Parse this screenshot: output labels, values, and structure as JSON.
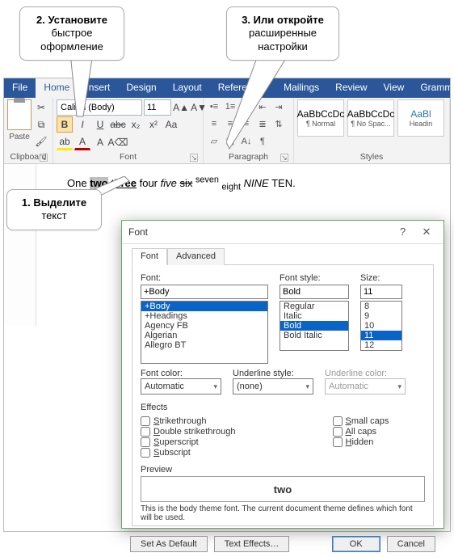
{
  "callouts": {
    "c1": {
      "bold": "1. Выделите",
      "rest": "текст"
    },
    "c2": {
      "bold": "2. Установите",
      "rest": "быстрое оформление"
    },
    "c3": {
      "bold": "3. Или откройте",
      "rest": "расширенные настройки"
    }
  },
  "ribbon": {
    "tabs": [
      "File",
      "Home",
      "Insert",
      "Design",
      "Layout",
      "References",
      "Mailings",
      "Review",
      "View",
      "Grammarly"
    ],
    "active_tab": "Home",
    "groups": {
      "clipboard": {
        "label": "Clipboard",
        "paste": "Paste"
      },
      "font": {
        "label": "Font",
        "name": "Calibri (Body)",
        "size": "11"
      },
      "paragraph": {
        "label": "Paragraph"
      },
      "styles": {
        "label": "Styles",
        "items": [
          {
            "sample": "AaBbCcDc",
            "name": "¶ Normal"
          },
          {
            "sample": "AaBbCcDc",
            "name": "¶ No Spac..."
          },
          {
            "sample": "AaBl",
            "name": "Headin"
          }
        ]
      }
    }
  },
  "document": {
    "tokens": [
      "One ",
      "two",
      " ",
      "three",
      " four ",
      "five",
      " ",
      "six",
      " ",
      "seven",
      " ",
      "eight",
      " ",
      "NINE",
      " TEN."
    ],
    "selected": "two"
  },
  "dialog": {
    "title": "Font",
    "help": "?",
    "close": "✕",
    "tabs": {
      "font": "Font",
      "advanced": "Advanced"
    },
    "labels": {
      "font": "Font:",
      "style": "Font style:",
      "size": "Size:",
      "fontcolor": "Font color:",
      "underlinestyle": "Underline style:",
      "underlinecolor": "Underline color:",
      "effects": "Effects",
      "preview": "Preview"
    },
    "font_input": "+Body",
    "font_list": [
      "+Body",
      "+Headings",
      "Agency FB",
      "Algerian",
      "Allegro BT"
    ],
    "style_input": "Bold",
    "style_list": [
      "Regular",
      "Italic",
      "Bold",
      "Bold Italic"
    ],
    "size_input": "11",
    "size_list": [
      "8",
      "9",
      "10",
      "11",
      "12"
    ],
    "fontcolor_value": "Automatic",
    "underlinestyle_value": "(none)",
    "underlinecolor_value": "Automatic",
    "effects_left": [
      "Strikethrough",
      "Double strikethrough",
      "Superscript",
      "Subscript"
    ],
    "effects_right": [
      "Small caps",
      "All caps",
      "Hidden"
    ],
    "preview_text": "two",
    "preview_note": "This is the body theme font. The current document theme defines which font will be used.",
    "buttons": {
      "setdefault": "Set As Default",
      "texteffects": "Text Effects…",
      "ok": "OK",
      "cancel": "Cancel"
    }
  }
}
